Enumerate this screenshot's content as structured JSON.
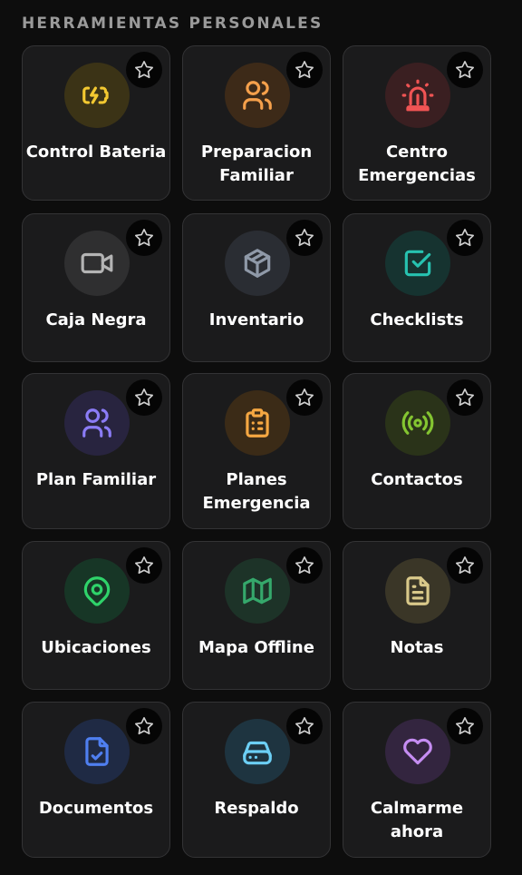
{
  "section": {
    "title": "HERRAMIENTAS PERSONALES"
  },
  "cards": [
    {
      "lines": [
        "Control Bateria"
      ],
      "icon": "battery-charging-icon",
      "color": "#f2c831",
      "bg": "#3b3316"
    },
    {
      "lines": [
        "Preparacion",
        "Familiar"
      ],
      "icon": "users-icon",
      "color": "#f5a04b",
      "bg": "#3d2a18"
    },
    {
      "lines": [
        "Centro",
        "Emergencias"
      ],
      "icon": "siren-icon",
      "color": "#f05454",
      "bg": "#3a1f21"
    },
    {
      "lines": [
        "Caja Negra"
      ],
      "icon": "video-camera-icon",
      "color": "#b4b4b4",
      "bg": "#2f2f30"
    },
    {
      "lines": [
        "Inventario"
      ],
      "icon": "package-icon",
      "color": "#8f99a8",
      "bg": "#2a2d33"
    },
    {
      "lines": [
        "Checklists"
      ],
      "icon": "checkbox-icon",
      "color": "#27c2b0",
      "bg": "#163330"
    },
    {
      "lines": [
        "Plan Familiar"
      ],
      "icon": "users-icon",
      "color": "#8b7cf6",
      "bg": "#28243f"
    },
    {
      "lines": [
        "Planes",
        "Emergencia"
      ],
      "icon": "clipboard-list-icon",
      "color": "#f5a742",
      "bg": "#3b2b17"
    },
    {
      "lines": [
        "Contactos"
      ],
      "icon": "radio-signal-icon",
      "color": "#84c531",
      "bg": "#2a3319"
    },
    {
      "lines": [
        "Ubicaciones"
      ],
      "icon": "map-pin-icon",
      "color": "#2fd36a",
      "bg": "#173626"
    },
    {
      "lines": [
        "Mapa Offline"
      ],
      "icon": "map-icon",
      "color": "#35a86b",
      "bg": "#1d3328"
    },
    {
      "lines": [
        "Notas"
      ],
      "icon": "document-text-icon",
      "color": "#d9c98a",
      "bg": "#3a3627"
    },
    {
      "lines": [
        "Documentos"
      ],
      "icon": "file-check-icon",
      "color": "#4f7ff0",
      "bg": "#1f2a44"
    },
    {
      "lines": [
        "Respaldo"
      ],
      "icon": "hard-drive-icon",
      "color": "#6ccff5",
      "bg": "#1e3440"
    },
    {
      "lines": [
        "Calmarme",
        "ahora"
      ],
      "icon": "heart-icon",
      "color": "#c58df2",
      "bg": "#33253f"
    }
  ]
}
